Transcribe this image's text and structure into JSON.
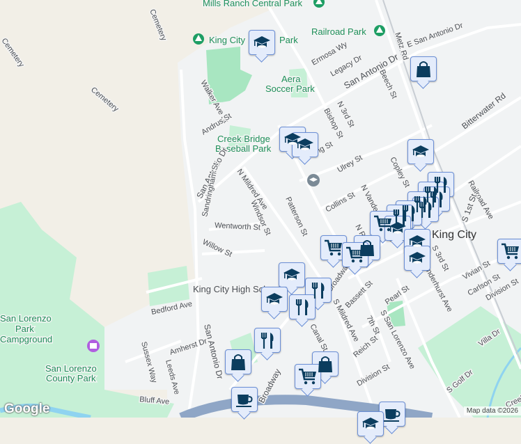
{
  "map": {
    "parks": [
      "Mills Ranch Central Park",
      "King City",
      "Park",
      "Railroad Park",
      "Aera",
      "Soccer Park",
      "Creek Bridge",
      "Baseball Park",
      "San Lorenzo",
      "Park",
      "Campground",
      "San Lorenzo",
      "County Park",
      "King City High School"
    ],
    "city_label": "King City",
    "streets": [
      "E San Antonio Dr",
      "Metz Rd",
      "Ermosa Wy",
      "Legacy Dr",
      "San Antonio Dr",
      "Beech St",
      "Walker Ave St",
      "Andrus St",
      "Bitterwater Rd",
      "Bishop St",
      "N 3rd St",
      "King St",
      "Ulrey St",
      "Copley St",
      "Cemetery",
      "Cemetery",
      "Cemetery",
      "San Antonio Dr",
      "N Mildred Ave",
      "Sandringham St",
      "Windsor St",
      "Patterson St",
      "Collins St",
      "N Vanderhurst Ave",
      "Wentworth St",
      "Willow St",
      "Railroad Ave",
      "S 1st St",
      "N Russ St",
      "S 3rd St",
      "Broadway St",
      "Vivian St",
      "Carlson St",
      "Division St",
      "Bedford Ave",
      "Bassett St",
      "Pearl St",
      "Vanderhurst Ave",
      "S Mildred Ave",
      "7th St",
      "S San Lorenzo Ave",
      "Canal St",
      "Villa Dr",
      "Amherst Dr",
      "Sussex Way",
      "Leeds Ave",
      "San Antonio Dr",
      "Broadway",
      "Reich St",
      "Division St",
      "S Golf Dr",
      "Bluff Ave",
      "Creek"
    ],
    "markers": [
      "school",
      "shopping-bag",
      "school",
      "school",
      "school",
      "restaurant",
      "restaurant",
      "restaurant",
      "restaurant",
      "restaurant",
      "restaurant",
      "restaurant",
      "shopping-cart",
      "school",
      "school",
      "school",
      "shopping-cart",
      "shopping-bag",
      "shopping-cart",
      "shopping-cart",
      "school",
      "restaurant",
      "school",
      "restaurant",
      "restaurant",
      "shopping-bag",
      "shopping-bag",
      "shopping-cart",
      "coffee",
      "coffee",
      "school"
    ],
    "logo": "Google",
    "attribution": "Map data ©2026"
  },
  "colors": {
    "urban": "#f1f3f4",
    "hills": "#f2efe7",
    "park": "#a8e6c1",
    "water": "#8fd3f0",
    "highway": "#8fa6c6",
    "marker_icon": "#0b3d5e",
    "marker_bg": "#e4ecfb"
  }
}
